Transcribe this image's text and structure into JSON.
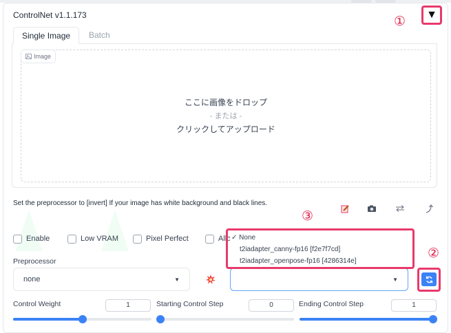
{
  "panel": {
    "title": "ControlNet v1.1.173",
    "collapse_glyph": "▼",
    "tabs": [
      {
        "label": "Single Image"
      },
      {
        "label": "Batch"
      }
    ],
    "image_label": "Image",
    "drop_text_1": "ここに画像をドロップ",
    "drop_text_2": "- または -",
    "drop_text_3": "クリックしてアップロード",
    "hint": "Set the preprocessor to [invert] If your image has white background and black lines.",
    "tool_icons": [
      "edit-icon",
      "camera-icon",
      "swap-icon",
      "curve-arrow-icon"
    ]
  },
  "checks": [
    {
      "label": "Enable",
      "checked": false
    },
    {
      "label": "Low VRAM",
      "checked": false
    },
    {
      "label": "Pixel Perfect",
      "checked": false
    },
    {
      "label": "Allo",
      "checked": false
    }
  ],
  "preprocessor": {
    "label": "Preprocessor",
    "value": "none"
  },
  "model": {
    "value": "",
    "options": [
      {
        "label": "None",
        "selected": true,
        "mark": "✓"
      },
      {
        "label": "t2iadapter_canny-fp16 [f2e7f7cd]",
        "selected": false
      },
      {
        "label": "t2iadapter_openpose-fp16 [4286314e]",
        "selected": false
      }
    ]
  },
  "sliders": [
    {
      "label": "Control Weight",
      "value": "1",
      "fraction": 0.5
    },
    {
      "label": "Starting Control Step",
      "value": "0",
      "fraction": 0.0
    },
    {
      "label": "Ending Control Step",
      "value": "1",
      "fraction": 1.0
    }
  ],
  "annotations": [
    "①",
    "②",
    "③"
  ],
  "colors": {
    "accent": "#3b82f6",
    "callout": "#e8396b",
    "annotation": "#e11d48"
  }
}
